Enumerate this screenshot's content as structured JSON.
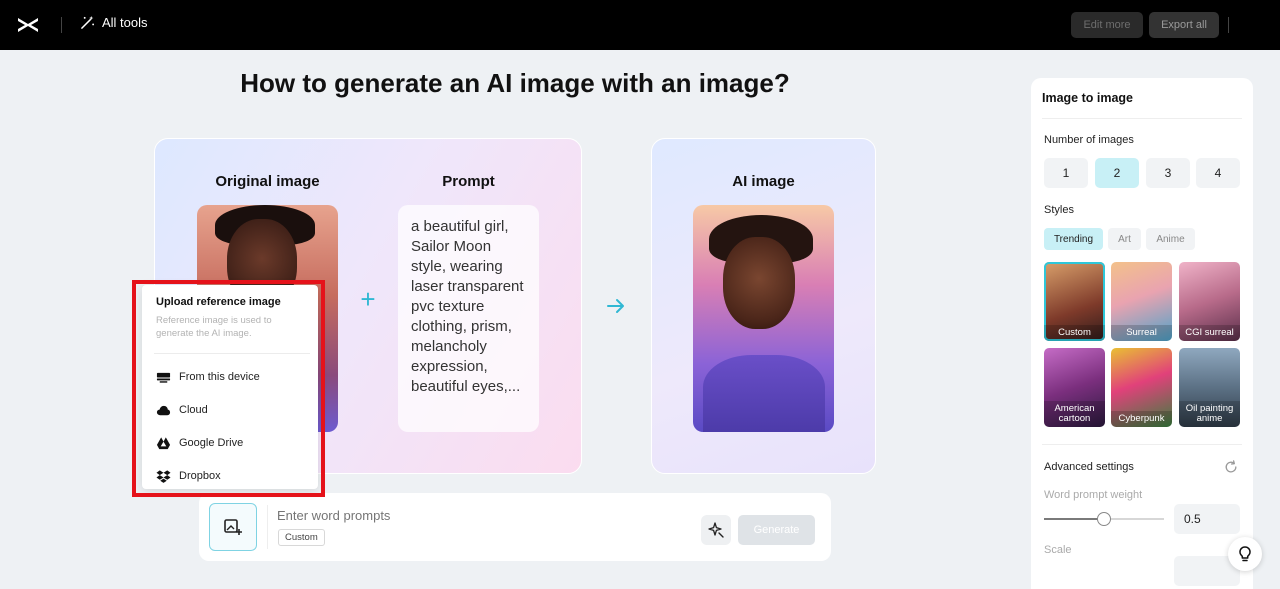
{
  "topbar": {
    "all_tools": "All tools",
    "edit_more": "Edit more",
    "export_all": "Export all"
  },
  "main": {
    "title": "How to generate an AI image with an image?",
    "original_label": "Original image",
    "prompt_label": "Prompt",
    "ai_label": "AI image",
    "prompt_text": "a beautiful girl, Sailor Moon style, wearing laser transparent pvc texture clothing, prism, melancholy expression, beautiful eyes,..."
  },
  "upload_menu": {
    "title": "Upload reference image",
    "description": "Reference image is used to generate the AI image.",
    "items": [
      {
        "label": "From this device",
        "icon": "device-icon"
      },
      {
        "label": "Cloud",
        "icon": "cloud-icon"
      },
      {
        "label": "Google Drive",
        "icon": "google-drive-icon"
      },
      {
        "label": "Dropbox",
        "icon": "dropbox-icon"
      }
    ]
  },
  "prompt_bar": {
    "placeholder": "Enter word prompts",
    "tag": "Custom",
    "generate": "Generate"
  },
  "panel": {
    "title": "Image to image",
    "number_label": "Number of images",
    "numbers": [
      "1",
      "2",
      "3",
      "4"
    ],
    "selected_number": "2",
    "styles_label": "Styles",
    "style_tabs": [
      "Trending",
      "Art",
      "Anime"
    ],
    "selected_tab": "Trending",
    "style_tiles": [
      "Custom",
      "Surreal",
      "CGI surreal",
      "American cartoon",
      "Cyberpunk",
      "Oil painting anime"
    ],
    "selected_tile": "Custom",
    "advanced_label": "Advanced settings",
    "weight_label": "Word prompt weight",
    "weight_value": "0.5",
    "scale_label": "Scale"
  },
  "colors": {
    "accent": "#2ec7d9",
    "highlight": "#e5121a"
  }
}
